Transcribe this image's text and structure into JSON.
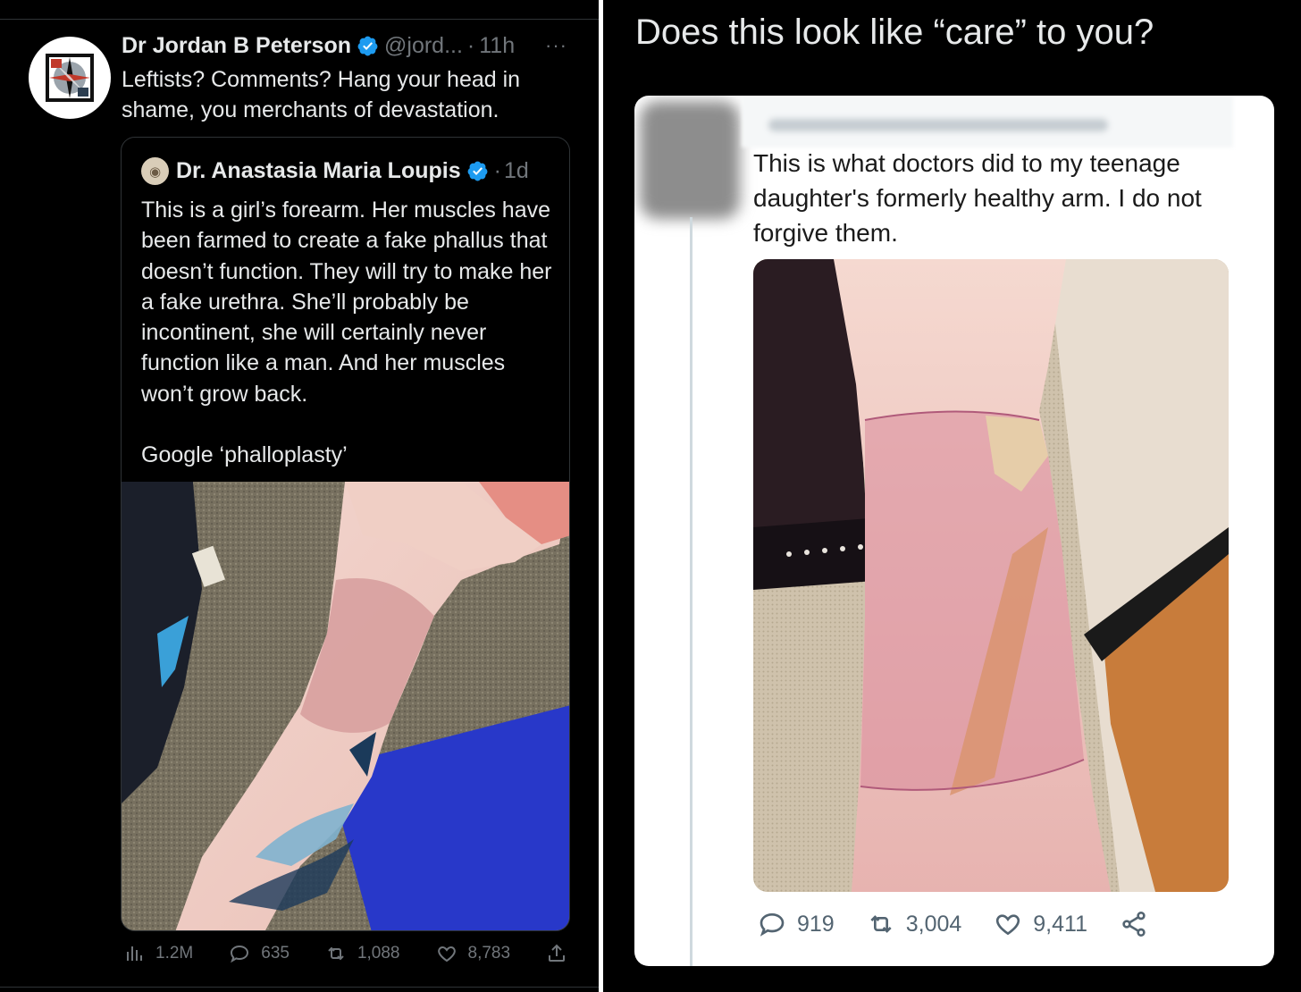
{
  "left_tweet": {
    "author_name": "Dr Jordan B Peterson",
    "handle": "@jord...",
    "separator": "·",
    "time": "11h",
    "more": "···",
    "text": "Leftists? Comments? Hang your head in shame, you merchants of devastation.",
    "quote": {
      "author_name": "Dr. Anastasia Maria Loupis",
      "separator": "·",
      "time": "1d",
      "paragraph_1": "This is a girl’s forearm. Her muscles have been farmed to create a fake phallus that doesn’t function. They will try to make her a fake urethra. She’ll probably be incontinent, she will certainly never function like a man. And her muscles won’t grow back.",
      "paragraph_2": "Google ‘phalloplasty’"
    },
    "actions": {
      "views": "1.2M",
      "replies": "635",
      "retweets": "1,088",
      "likes": "8,783"
    }
  },
  "right_panel": {
    "title": "Does this look like “care” to you?",
    "embedded_tweet": {
      "text": "This is what doctors did to my teenage daughter's formerly healthy arm. I do not forgive them.",
      "actions": {
        "replies": "919",
        "retweets": "3,004",
        "likes": "9,411"
      }
    }
  },
  "colors": {
    "background": "#000000",
    "verified_blue": "#1d9bf0",
    "muted_text": "#71767b",
    "card_background": "#ffffff"
  }
}
